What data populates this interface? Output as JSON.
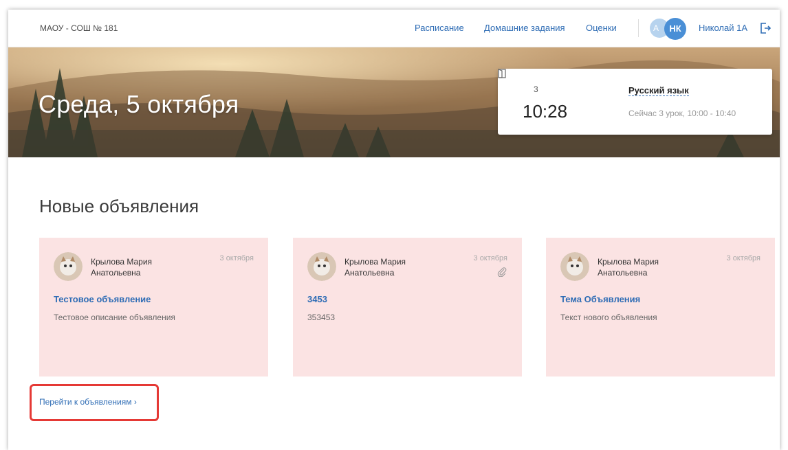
{
  "header": {
    "school_name": "МАОУ - СОШ № 181",
    "nav": [
      "Расписание",
      "Домашние задания",
      "Оценки"
    ],
    "avatar_back": "А",
    "avatar_initials": "НК",
    "user_name": "Николай 1А",
    "logout_icon": "logout-icon",
    "accent_color": "#2f6db5"
  },
  "hero": {
    "date_title": "Среда, 5 октября",
    "lesson": {
      "room_icon": "door-icon",
      "room": "3",
      "time": "10:28",
      "subject": "Русский язык",
      "now_text": "Сейчас 3 урок, 10:00 - 10:40"
    }
  },
  "announcements": {
    "title": "Новые объявления",
    "cards": [
      {
        "author": "Крылова Мария Анатольевна",
        "date": "3 октября",
        "title": "Тестовое объявление",
        "text": "Тестовое описание объявления",
        "attachment": false
      },
      {
        "author": "Крылова Мария Анатольевна",
        "date": "3 октября",
        "title": "3453",
        "text": "353453",
        "attachment": true
      },
      {
        "author": "Крылова Мария Анатольевна",
        "date": "3 октября",
        "title": "Тема Объявления",
        "text": "Текст нового объявления",
        "attachment": false
      }
    ],
    "goto_link": "Перейти к объявлениям",
    "goto_chevron": "›",
    "card_color": "#fbe3e3",
    "highlight_color": "#e53935"
  }
}
